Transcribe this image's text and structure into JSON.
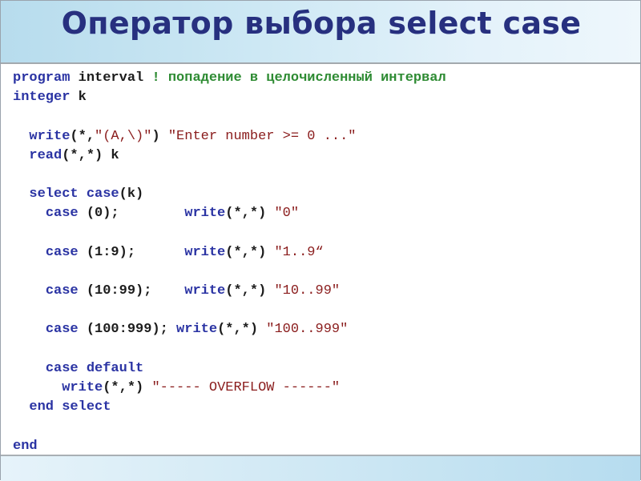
{
  "slide": {
    "title": "Оператор выбора select case"
  },
  "code": {
    "lines": [
      [
        {
          "t": "program",
          "k": "kw"
        },
        {
          "t": " interval ",
          "k": "plain"
        },
        {
          "t": "! попадение в целочисленный интервал",
          "k": "cmt"
        }
      ],
      [
        {
          "t": "integer",
          "k": "kw"
        },
        {
          "t": " k",
          "k": "plain"
        }
      ],
      [],
      [
        {
          "t": "  ",
          "k": "plain"
        },
        {
          "t": "write",
          "k": "kw"
        },
        {
          "t": "(*,",
          "k": "plain"
        },
        {
          "t": "\"(A,\\)\"",
          "k": "str"
        },
        {
          "t": ") ",
          "k": "plain"
        },
        {
          "t": "\"Enter number >= 0 ...\"",
          "k": "str"
        }
      ],
      [
        {
          "t": "  ",
          "k": "plain"
        },
        {
          "t": "read",
          "k": "kw"
        },
        {
          "t": "(*,*) k",
          "k": "plain"
        }
      ],
      [],
      [
        {
          "t": "  ",
          "k": "plain"
        },
        {
          "t": "select case",
          "k": "kw"
        },
        {
          "t": "(k)",
          "k": "plain"
        }
      ],
      [
        {
          "t": "    ",
          "k": "plain"
        },
        {
          "t": "case",
          "k": "kw"
        },
        {
          "t": " (0);        ",
          "k": "plain"
        },
        {
          "t": "write",
          "k": "kw"
        },
        {
          "t": "(*,*) ",
          "k": "plain"
        },
        {
          "t": "\"0\"",
          "k": "str"
        }
      ],
      [],
      [
        {
          "t": "    ",
          "k": "plain"
        },
        {
          "t": "case",
          "k": "kw"
        },
        {
          "t": " (1:9);      ",
          "k": "plain"
        },
        {
          "t": "write",
          "k": "kw"
        },
        {
          "t": "(*,*) ",
          "k": "plain"
        },
        {
          "t": "\"1..9“",
          "k": "str"
        }
      ],
      [],
      [
        {
          "t": "    ",
          "k": "plain"
        },
        {
          "t": "case",
          "k": "kw"
        },
        {
          "t": " (10:99);    ",
          "k": "plain"
        },
        {
          "t": "write",
          "k": "kw"
        },
        {
          "t": "(*,*) ",
          "k": "plain"
        },
        {
          "t": "\"10..99\"",
          "k": "str"
        }
      ],
      [],
      [
        {
          "t": "    ",
          "k": "plain"
        },
        {
          "t": "case",
          "k": "kw"
        },
        {
          "t": " (100:999); ",
          "k": "plain"
        },
        {
          "t": "write",
          "k": "kw"
        },
        {
          "t": "(*,*) ",
          "k": "plain"
        },
        {
          "t": "\"100..999\"",
          "k": "str"
        }
      ],
      [],
      [
        {
          "t": "    ",
          "k": "plain"
        },
        {
          "t": "case default",
          "k": "kw"
        }
      ],
      [
        {
          "t": "      ",
          "k": "plain"
        },
        {
          "t": "write",
          "k": "kw"
        },
        {
          "t": "(*,*) ",
          "k": "plain"
        },
        {
          "t": "\"----- OVERFLOW ------\"",
          "k": "str"
        }
      ],
      [
        {
          "t": "  ",
          "k": "plain"
        },
        {
          "t": "end select",
          "k": "kw"
        }
      ],
      [],
      [
        {
          "t": "end",
          "k": "kw"
        }
      ]
    ]
  },
  "colors": {
    "title": "#27307f",
    "keyword": "#2a33a3",
    "string": "#8a1c1c",
    "comment": "#2e8b33",
    "plain": "#1c1c1c"
  }
}
